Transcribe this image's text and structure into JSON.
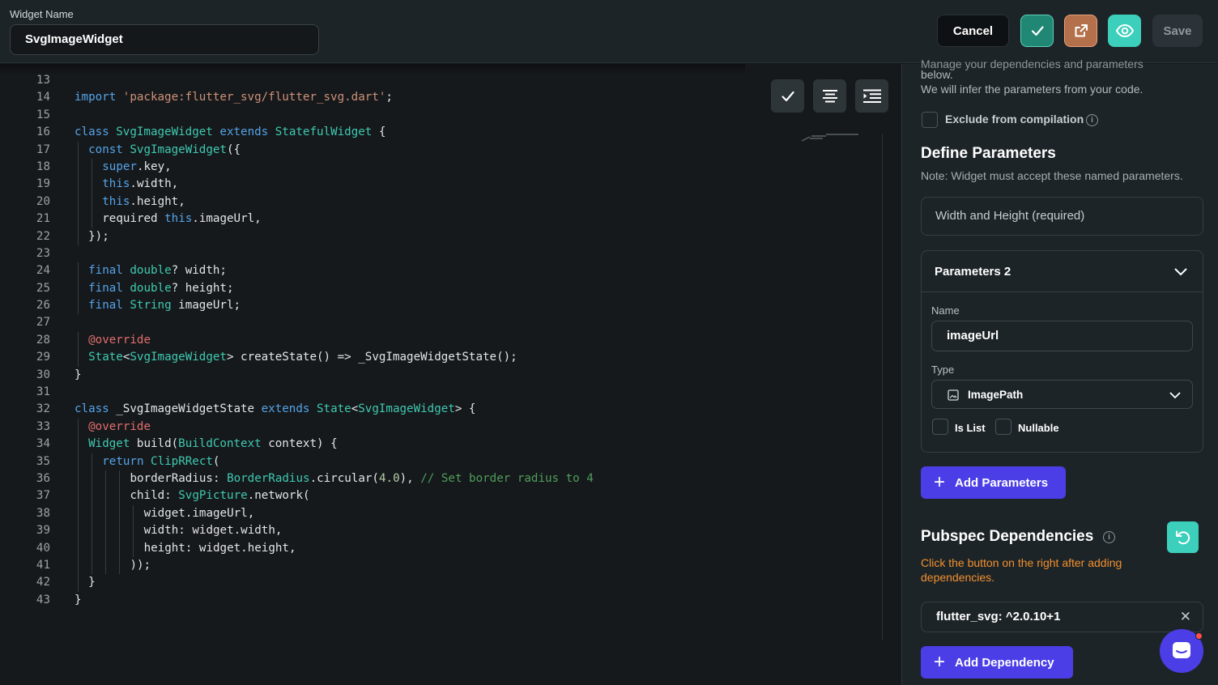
{
  "header": {
    "widget_name_label": "Widget Name",
    "widget_name_value": "SvgImageWidget",
    "cancel_label": "Cancel",
    "save_label": "Save",
    "icons": [
      "check-icon",
      "external-link-icon",
      "eye-icon"
    ]
  },
  "editor": {
    "lines": [
      {
        "n": "13",
        "indent": 0,
        "t": []
      },
      {
        "n": "14",
        "indent": 0,
        "t": [
          [
            "kw",
            "import"
          ],
          [
            "p",
            " "
          ],
          [
            "st",
            "'package:flutter_svg/flutter_svg.dart'"
          ],
          [
            "p",
            ";"
          ]
        ]
      },
      {
        "n": "15",
        "indent": 0,
        "t": []
      },
      {
        "n": "16",
        "indent": 0,
        "t": [
          [
            "kw",
            "class"
          ],
          [
            "p",
            " "
          ],
          [
            "ty",
            "SvgImageWidget"
          ],
          [
            "p",
            " "
          ],
          [
            "kw",
            "extends"
          ],
          [
            "p",
            " "
          ],
          [
            "ty",
            "StatefulWidget"
          ],
          [
            "p",
            " {"
          ]
        ]
      },
      {
        "n": "17",
        "indent": 1,
        "t": [
          [
            "kw",
            "const"
          ],
          [
            "p",
            " "
          ],
          [
            "ty",
            "SvgImageWidget"
          ],
          [
            "p",
            "({"
          ]
        ]
      },
      {
        "n": "18",
        "indent": 2,
        "t": [
          [
            "kw",
            "super"
          ],
          [
            "p",
            ".key,"
          ]
        ]
      },
      {
        "n": "19",
        "indent": 2,
        "t": [
          [
            "kw",
            "this"
          ],
          [
            "p",
            ".width,"
          ]
        ]
      },
      {
        "n": "20",
        "indent": 2,
        "t": [
          [
            "kw",
            "this"
          ],
          [
            "p",
            ".height,"
          ]
        ]
      },
      {
        "n": "21",
        "indent": 2,
        "t": [
          [
            "p",
            "required "
          ],
          [
            "kw",
            "this"
          ],
          [
            "p",
            ".imageUrl,"
          ]
        ]
      },
      {
        "n": "22",
        "indent": 1,
        "t": [
          [
            "p",
            "});"
          ]
        ]
      },
      {
        "n": "23",
        "indent": 0,
        "t": []
      },
      {
        "n": "24",
        "indent": 1,
        "t": [
          [
            "kw",
            "final"
          ],
          [
            "p",
            " "
          ],
          [
            "ty",
            "double"
          ],
          [
            "p",
            "? width;"
          ]
        ]
      },
      {
        "n": "25",
        "indent": 1,
        "t": [
          [
            "kw",
            "final"
          ],
          [
            "p",
            " "
          ],
          [
            "ty",
            "double"
          ],
          [
            "p",
            "? height;"
          ]
        ]
      },
      {
        "n": "26",
        "indent": 1,
        "t": [
          [
            "kw",
            "final"
          ],
          [
            "p",
            " "
          ],
          [
            "ty",
            "String"
          ],
          [
            "p",
            " imageUrl;"
          ]
        ]
      },
      {
        "n": "27",
        "indent": 0,
        "t": []
      },
      {
        "n": "28",
        "indent": 1,
        "t": [
          [
            "an",
            "@override"
          ]
        ]
      },
      {
        "n": "29",
        "indent": 1,
        "t": [
          [
            "ty",
            "State"
          ],
          [
            "p",
            "<"
          ],
          [
            "ty",
            "SvgImageWidget"
          ],
          [
            "p",
            "> createState() => _SvgImageWidgetState();"
          ]
        ]
      },
      {
        "n": "30",
        "indent": 0,
        "t": [
          [
            "p",
            "}"
          ]
        ]
      },
      {
        "n": "31",
        "indent": 0,
        "t": []
      },
      {
        "n": "32",
        "indent": 0,
        "t": [
          [
            "kw",
            "class"
          ],
          [
            "p",
            " _SvgImageWidgetState "
          ],
          [
            "kw",
            "extends"
          ],
          [
            "p",
            " "
          ],
          [
            "ty",
            "State"
          ],
          [
            "p",
            "<"
          ],
          [
            "ty",
            "SvgImageWidget"
          ],
          [
            "p",
            "> {"
          ]
        ]
      },
      {
        "n": "33",
        "indent": 1,
        "t": [
          [
            "an",
            "@override"
          ]
        ]
      },
      {
        "n": "34",
        "indent": 1,
        "t": [
          [
            "ty",
            "Widget"
          ],
          [
            "p",
            " build("
          ],
          [
            "ty",
            "BuildContext"
          ],
          [
            "p",
            " context) {"
          ]
        ]
      },
      {
        "n": "35",
        "indent": 2,
        "t": [
          [
            "kw",
            "return"
          ],
          [
            "p",
            " "
          ],
          [
            "ty",
            "ClipRRect"
          ],
          [
            "p",
            "("
          ]
        ]
      },
      {
        "n": "36",
        "indent": 4,
        "t": [
          [
            "p",
            "borderRadius: "
          ],
          [
            "ty",
            "BorderRadius"
          ],
          [
            "p",
            ".circular("
          ],
          [
            "nm",
            "4.0"
          ],
          [
            "p",
            "), "
          ],
          [
            "cm",
            "// Set border radius to 4"
          ]
        ]
      },
      {
        "n": "37",
        "indent": 4,
        "t": [
          [
            "p",
            "child: "
          ],
          [
            "ty",
            "SvgPicture"
          ],
          [
            "p",
            ".network("
          ]
        ]
      },
      {
        "n": "38",
        "indent": 5,
        "t": [
          [
            "p",
            "widget.imageUrl,"
          ]
        ]
      },
      {
        "n": "39",
        "indent": 5,
        "t": [
          [
            "p",
            "width: widget.width,"
          ]
        ]
      },
      {
        "n": "40",
        "indent": 5,
        "t": [
          [
            "p",
            "height: widget.height,"
          ]
        ]
      },
      {
        "n": "41",
        "indent": 4,
        "t": [
          [
            "p",
            "));"
          ]
        ]
      },
      {
        "n": "42",
        "indent": 1,
        "t": [
          [
            "p",
            "}"
          ]
        ]
      },
      {
        "n": "43",
        "indent": 0,
        "t": [
          [
            "p",
            "}"
          ]
        ]
      }
    ],
    "tools": [
      "check-icon",
      "align-center-icon",
      "indent-icon"
    ]
  },
  "panel": {
    "cut_text": "Manage your dependencies and parameters",
    "below": "below.",
    "infer": "We will infer the parameters from your code.",
    "exclude_label": "Exclude from compilation",
    "define_title": "Define Parameters",
    "define_note": "Note: Widget must accept these named parameters.",
    "wh_label": "Width and Height (required)",
    "param_title": "Parameters 2",
    "name_label": "Name",
    "name_value": "imageUrl",
    "type_label": "Type",
    "type_value": "ImagePath",
    "is_list": "Is List",
    "nullable": "Nullable",
    "add_params": "Add Parameters",
    "pubspec_title": "Pubspec Dependencies",
    "warning": "Click the button on the right after adding dependencies.",
    "dependency": "flutter_svg: ^2.0.10+1",
    "add_dependency": "Add Dependency"
  },
  "colors": {
    "accent": "#4b3ee6",
    "teal": "#3ccfbb",
    "warning": "#f2902e",
    "background": "#1d2428"
  }
}
